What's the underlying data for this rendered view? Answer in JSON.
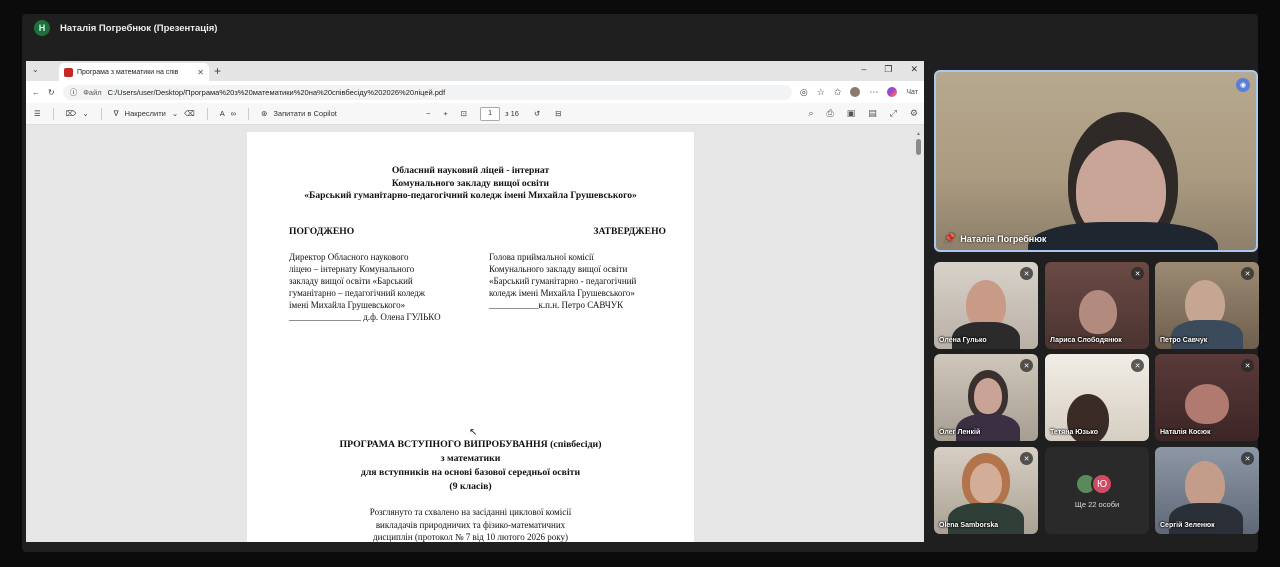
{
  "meeting": {
    "presenter_avatar": "Н",
    "presenter_title": "Наталія Погребнюк (Презентація)"
  },
  "browser": {
    "tab_title": "Програма з математики на спів",
    "tab_close": "✕",
    "new_tab": "+",
    "address_label": "Файл",
    "address_url": "C:/Users/user/Desktop/Програма%20з%20математики%20на%20співбесіду%202026%20ліцей.pdf",
    "chat_label": "Чат"
  },
  "pdf_toolbar": {
    "draw_label": "Накреслити",
    "copilot_label": "Запитати в Copilot",
    "page_current": "1",
    "page_total": "з 16"
  },
  "document": {
    "org_line1": "Обласний науковий ліцей - інтернат",
    "org_line2": "Комунального закладу вищої освіти",
    "org_line3": "«Барський гуманітарно-педагогічний коледж імені Михайла Грушевського»",
    "agreed": "ПОГОДЖЕНО",
    "approved": "ЗАТВЕРДЖЕНО",
    "left_l1": "Директор Обласного наукового",
    "left_l2": "ліцею – інтернату Комунального",
    "left_l3": "закладу вищої освіти «Барський",
    "left_l4": "гуманітарно – педагогічний коледж",
    "left_l5": "імені Михайла Грушевського»",
    "left_l6": "________________ д.ф. Олена ГУЛЬКО",
    "right_l1": "Голова приймальної комісії",
    "right_l2": "Комунального закладу вищої освіти",
    "right_l3": "«Барський гуманітарно - педагогічний",
    "right_l4": "коледж імені Михайла Грушевського»",
    "right_l5": "___________к.п.н. Петро САВЧУК",
    "prog_l1": "ПРОГРАМА ВСТУПНОГО ВИПРОБУВАННЯ (співбесіди)",
    "prog_l2": "з математики",
    "prog_l3": "для вступників на основі базової середньої освіти",
    "prog_l4": "(9 класів)",
    "note_l1": "Розглянуто та схвалено на засіданні циклової комісії",
    "note_l2": "викладачів природничих та фізико-математичних",
    "note_l3": "дисциплін (протокол № 7 від 10 лютого 2026 року)"
  },
  "participants": {
    "main_name": "Наталія Погребнюк",
    "p1": "Олена Гулько",
    "p2": "Лариса Слободянюк",
    "p3": "Петро Савчук",
    "p4": "Олег Ленкій",
    "p5": "Тетяна Юзько",
    "p6": "Наталія Косюк",
    "p7": "Olena Samborska",
    "more_avatar": "Ю",
    "more_label": "Ще 22 особи",
    "p8": "Сергій Зеленюк"
  },
  "colors": {
    "accent_presenter_border": "#a9c7f0",
    "presenter_avatar_bg": "#1f6f3a",
    "more_avatar_bg": "#d24a62"
  }
}
